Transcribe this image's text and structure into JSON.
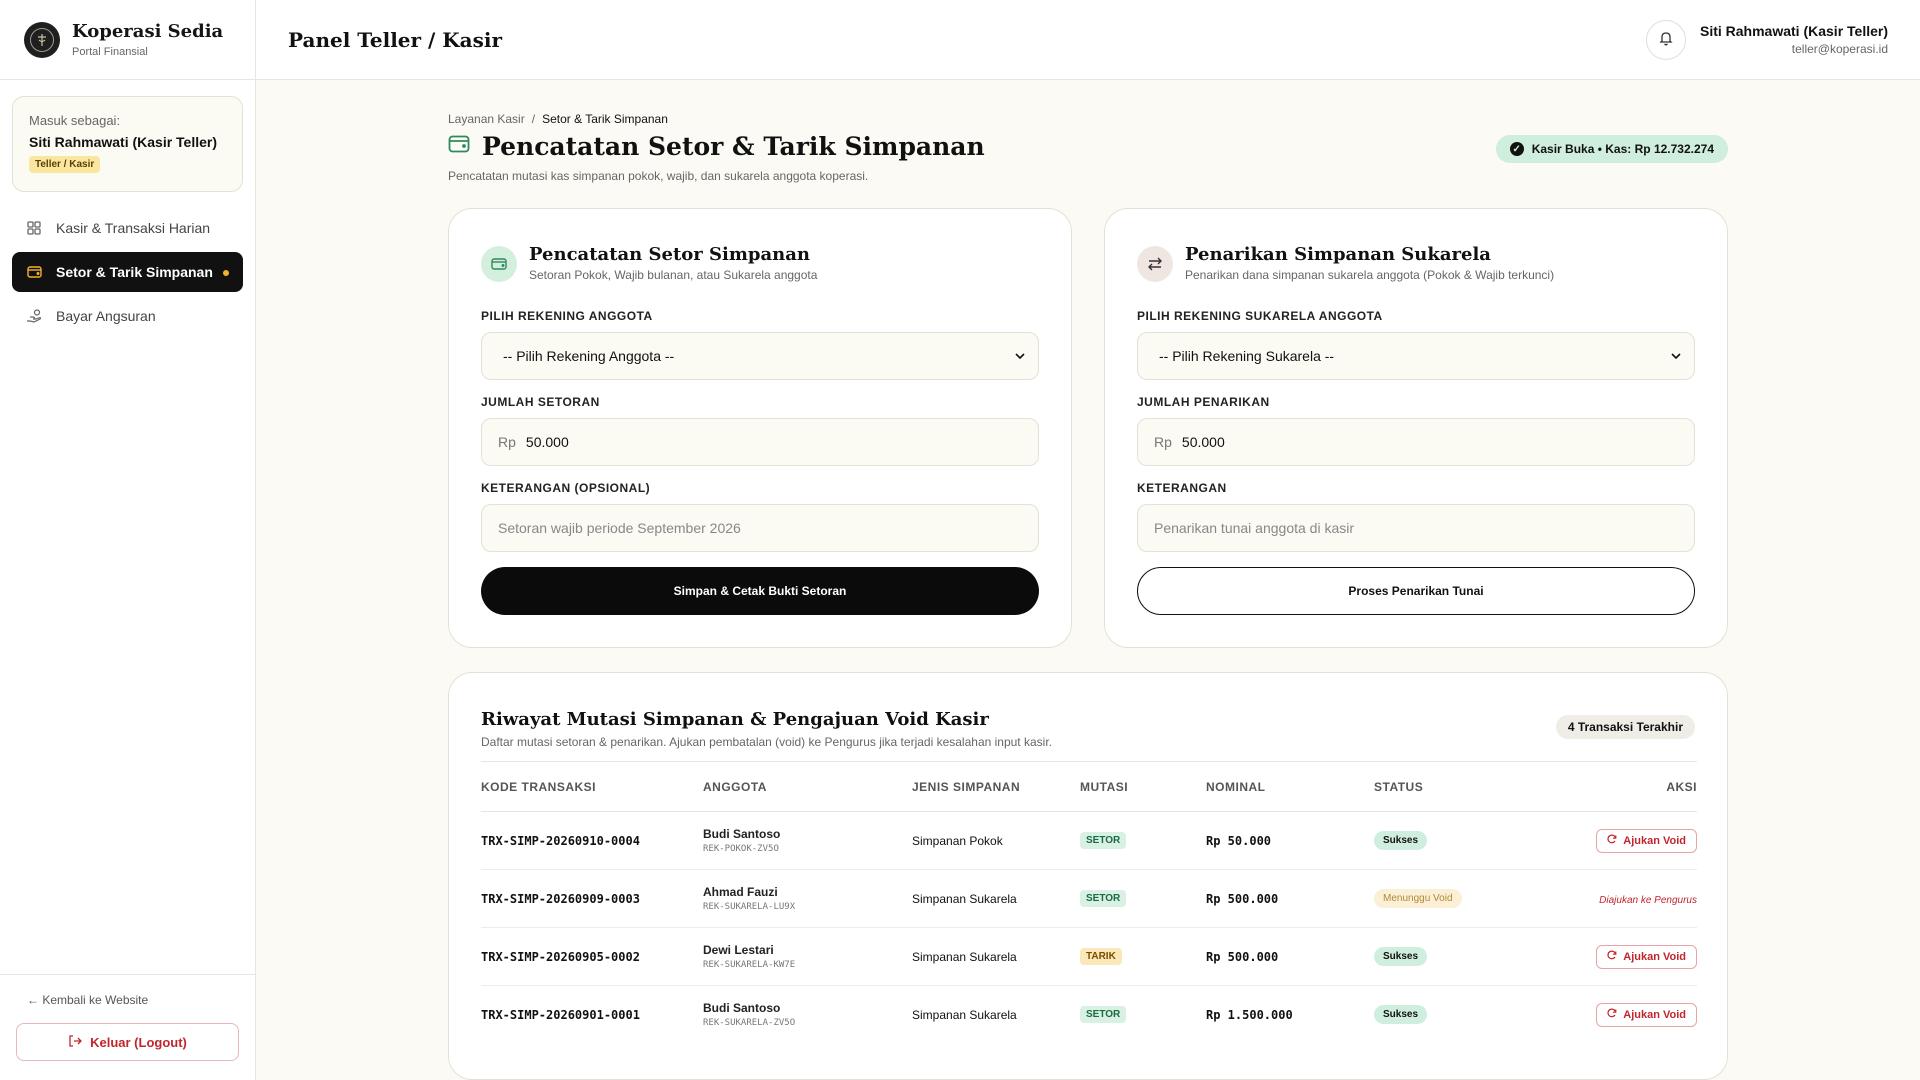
{
  "brand": {
    "name": "Koperasi Sedia",
    "subtitle": "Portal Finansial"
  },
  "sidebar": {
    "login_label": "Masuk sebagai:",
    "user_name": "Siti Rahmawati (Kasir Teller)",
    "role": "Teller / Kasir",
    "items": [
      {
        "label": "Kasir & Transaksi Harian",
        "icon": "grid-icon"
      },
      {
        "label": "Setor & Tarik Simpanan",
        "icon": "wallet-icon",
        "active": true
      },
      {
        "label": "Bayar Angsuran",
        "icon": "hand-coins-icon"
      }
    ],
    "back_link": "← Kembali ke Website",
    "logout": "Keluar (Logout)"
  },
  "header": {
    "title": "Panel Teller / Kasir",
    "user_name": "Siti Rahmawati (Kasir Teller)",
    "user_email": "teller@koperasi.id"
  },
  "page": {
    "breadcrumb": [
      "Layanan Kasir",
      "Setor & Tarik Simpanan"
    ],
    "title": "Pencatatan Setor & Tarik Simpanan",
    "subtitle": "Pencatatan mutasi kas simpanan pokok, wajib, dan sukarela anggota koperasi.",
    "status": "Kasir Buka • Kas: Rp 12.732.274"
  },
  "deposit": {
    "title": "Pencatatan Setor Simpanan",
    "desc": "Setoran Pokok, Wajib bulanan, atau Sukarela anggota",
    "account_label": "PILIH REKENING ANGGOTA",
    "account_value": "-- Pilih Rekening Anggota --",
    "amount_label": "JUMLAH SETORAN",
    "currency": "Rp",
    "amount_value": "50.000",
    "note_label": "KETERANGAN (OPSIONAL)",
    "note_placeholder": "Setoran wajib periode September 2026",
    "submit": "Simpan & Cetak Bukti Setoran"
  },
  "withdraw": {
    "title": "Penarikan Simpanan Sukarela",
    "desc": "Penarikan dana simpanan sukarela anggota (Pokok & Wajib terkunci)",
    "account_label": "PILIH REKENING SUKARELA ANGGOTA",
    "account_value": "-- Pilih Rekening Sukarela --",
    "amount_label": "JUMLAH PENARIKAN",
    "currency": "Rp",
    "amount_value": "50.000",
    "note_label": "KETERANGAN",
    "note_placeholder": "Penarikan tunai anggota di kasir",
    "submit": "Proses Penarikan Tunai"
  },
  "history": {
    "title": "Riwayat Mutasi Simpanan & Pengajuan Void Kasir",
    "desc": "Daftar mutasi setoran & penarikan. Ajukan pembatalan (void) ke Pengurus jika terjadi kesalahan input kasir.",
    "count": "4 Transaksi Terakhir",
    "columns": [
      "KODE TRANSAKSI",
      "ANGGOTA",
      "JENIS SIMPANAN",
      "MUTASI",
      "NOMINAL",
      "STATUS",
      "AKSI"
    ],
    "rows": [
      {
        "code": "TRX-SIMP-20260910-0004",
        "member": "Budi Santoso",
        "account": "REK-POKOK-ZV5O",
        "type": "Simpanan Pokok",
        "mutation": "SETOR",
        "amount": "Rp 50.000",
        "status": "Sukses",
        "action": "Ajukan Void"
      },
      {
        "code": "TRX-SIMP-20260909-0003",
        "member": "Ahmad Fauzi",
        "account": "REK-SUKARELA-LU9X",
        "type": "Simpanan Sukarela",
        "mutation": "SETOR",
        "amount": "Rp 500.000",
        "status": "Menunggu Void",
        "action": "Diajukan ke Pengurus"
      },
      {
        "code": "TRX-SIMP-20260905-0002",
        "member": "Dewi Lestari",
        "account": "REK-SUKARELA-KW7E",
        "type": "Simpanan Sukarela",
        "mutation": "TARIK",
        "amount": "Rp 500.000",
        "status": "Sukses",
        "action": "Ajukan Void"
      },
      {
        "code": "TRX-SIMP-20260901-0001",
        "member": "Budi Santoso",
        "account": "REK-SUKARELA-ZV5O",
        "type": "Simpanan Sukarela",
        "mutation": "SETOR",
        "amount": "Rp 1.500.000",
        "status": "Sukses",
        "action": "Ajukan Void"
      }
    ]
  }
}
